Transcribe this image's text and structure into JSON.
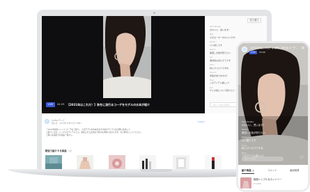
{
  "video": {
    "live_badge": "LIVE",
    "duration": "44:09",
    "title": "【2021年はこれだ！】秋冬に流行るコーデをモデルの水本が紹介"
  },
  "chat": {
    "select_label": "並び替え",
    "items": [
      {
        "user": "Sam Tanaka",
        "text": "かわいい、買います！"
      },
      {
        "user": "ゆみ",
        "text": "そのセーターかわいいです！"
      },
      {
        "user": "Ryota Y",
        "text": "いい感じです"
      },
      {
        "user": "Naomi",
        "text": "着回しの技が知りたい"
      },
      {
        "user": "Jun",
        "text": "素材感も良さそうです"
      },
      {
        "user": "Hana",
        "text": "秋にぴったりですね"
      },
      {
        "user": "Tomo K",
        "text": "何色がありますか？"
      },
      {
        "user": "Mika",
        "text": "このアイテム欲しい！"
      },
      {
        "user": "Ken",
        "text": "サイズ感について知りたい"
      }
    ],
    "input_placeholder": "コメントを入力する",
    "send_label": "送信"
  },
  "channel": {
    "name": "Shifterテレビ",
    "meta": "配信日：2021年10月15日 19時〜"
  },
  "description": [
    "「2021年秋冬トレンドコーデをご紹介」、人気モデルの水本がおすすめのアイテムを実際に着用して",
    "ご紹介します。シンプルなアイテムでも、着回しの工夫次第で様々な印象に変わります。ぜひ参考にしてください。",
    "ご購入は画面下の商品一覧から。"
  ],
  "follow_label": "フォロー",
  "products": {
    "heading": "配信で紹介する商品",
    "count": "7点"
  },
  "phone": {
    "title": "【2021年はこれだ！】秋冬に流行るコーデ...",
    "live_badge": "LIVE",
    "time": "44:09",
    "close_icon": "×",
    "chat": [
      {
        "user": "Sam Tanaka",
        "text": "かわいい、買います！"
      },
      {
        "user": "Naomi",
        "text": "着回しの技が知りたい"
      },
      {
        "user": "Ryota Y",
        "text": "いい感じです"
      },
      {
        "user": "Hana",
        "text": "秋にぴったりですね"
      },
      {
        "user": "Mika",
        "text": "このアイテム欲しい！"
      }
    ],
    "input_placeholder": "コメントする",
    "heart_icon": "♡",
    "tabs": [
      {
        "label": "紹介商品",
        "count": "7"
      },
      {
        "label": "コメント"
      },
      {
        "label": "番組概要"
      }
    ],
    "product": {
      "name": "構造シンプルなカットソー",
      "sub": "¥ 9,900"
    }
  },
  "colors": {
    "live_badge": "#3a5ad8",
    "laptop_body": "#e3e4e6",
    "player_bg": "#0e0e10"
  }
}
